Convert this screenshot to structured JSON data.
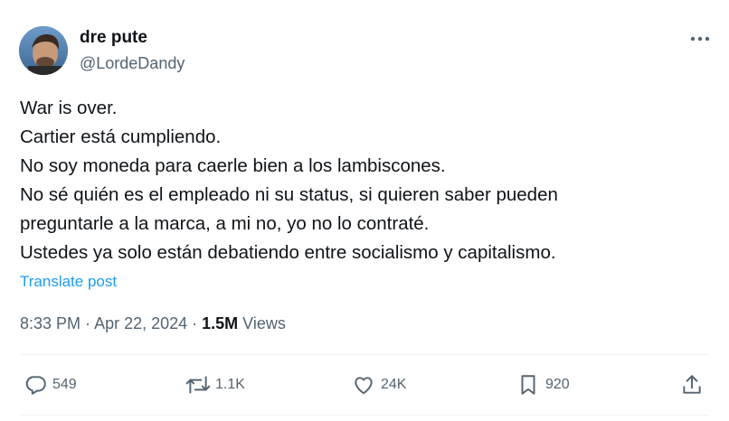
{
  "author": {
    "display_name": "dre pute",
    "handle": "@LordeDandy",
    "avatar_icon": "user-avatar"
  },
  "tweet": {
    "lines": [
      "War is over.",
      "Cartier está cumpliendo.",
      "No soy moneda para caerle bien a los lambiscones.",
      "No sé quién es el empleado ni su status, si quieren saber pueden",
      "preguntarle a la marca, a mi no, yo no lo contraté.",
      "Ustedes ya solo están debatiendo entre socialismo y capitalismo."
    ],
    "translate_label": "Translate post",
    "time": "8:33 PM",
    "separator": " · ",
    "date": "Apr 22, 2024",
    "views_count": "1.5M",
    "views_label": " Views"
  },
  "actions": {
    "replies": "549",
    "retweets": "1.1K",
    "likes": "24K",
    "bookmarks": "920"
  },
  "colors": {
    "accent": "#1d9bf0",
    "text": "#0f1419",
    "secondary": "#536471"
  }
}
